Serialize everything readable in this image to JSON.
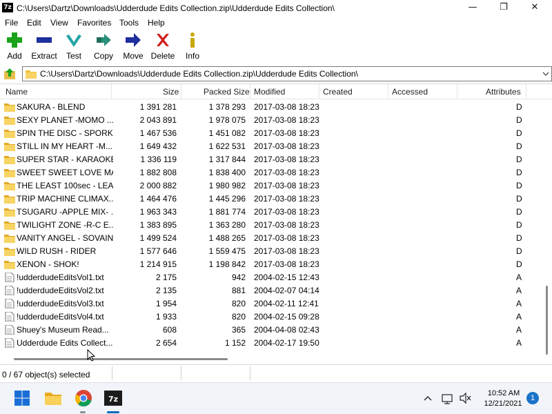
{
  "window": {
    "app_icon_text": "7z",
    "title": "C:\\Users\\Dartz\\Downloads\\Udderdude Edits Collection.zip\\Udderdude Edits Collection\\",
    "minimize_glyph": "—",
    "maximize_glyph": "❐",
    "close_glyph": "✕"
  },
  "menu": {
    "items": [
      "File",
      "Edit",
      "View",
      "Favorites",
      "Tools",
      "Help"
    ]
  },
  "toolbar": {
    "buttons": [
      {
        "label": "Add",
        "icon": "plus-icon",
        "color": "#1aa31a"
      },
      {
        "label": "Extract",
        "icon": "minus-icon",
        "color": "#1f2f9e"
      },
      {
        "label": "Test",
        "icon": "check-icon",
        "color": "#26a5a5"
      },
      {
        "label": "Copy",
        "icon": "double-arrow-icon",
        "color": "#2a8f7a"
      },
      {
        "label": "Move",
        "icon": "arrow-right-icon",
        "color": "#1f2f9e"
      },
      {
        "label": "Delete",
        "icon": "x-icon",
        "color": "#d11f1f"
      },
      {
        "label": "Info",
        "icon": "info-icon",
        "color": "#c9a800"
      }
    ]
  },
  "address": {
    "path": "C:\\Users\\Dartz\\Downloads\\Udderdude Edits Collection.zip\\Udderdude Edits Collection\\"
  },
  "columns": {
    "name": "Name",
    "size": "Size",
    "packed": "Packed Size",
    "modified": "Modified",
    "created": "Created",
    "accessed": "Accessed",
    "attributes": "Attributes"
  },
  "files": [
    {
      "name": "SAKURA - BLEND",
      "size": "1 391 281",
      "packed": "1 378 293",
      "modified": "2017-03-08 18:23",
      "attr": "D",
      "type": "folder"
    },
    {
      "name": "SEXY PLANET -MOMO ...",
      "size": "2 043 891",
      "packed": "1 978 075",
      "modified": "2017-03-08 18:23",
      "attr": "D",
      "type": "folder"
    },
    {
      "name": "SPIN THE DISC - SPORK",
      "size": "1 467 536",
      "packed": "1 451 082",
      "modified": "2017-03-08 18:23",
      "attr": "D",
      "type": "folder"
    },
    {
      "name": "STILL IN MY HEART -M...",
      "size": "1 649 432",
      "packed": "1 622 531",
      "modified": "2017-03-08 18:23",
      "attr": "D",
      "type": "folder"
    },
    {
      "name": "SUPER STAR - KARAOKE",
      "size": "1 336 119",
      "packed": "1 317 844",
      "modified": "2017-03-08 18:23",
      "attr": "D",
      "type": "folder"
    },
    {
      "name": "SWEET SWEET LOVE MA...",
      "size": "1 882 808",
      "packed": "1 838 400",
      "modified": "2017-03-08 18:23",
      "attr": "D",
      "type": "folder"
    },
    {
      "name": "THE LEAST 100sec - LEA...",
      "size": "2 000 882",
      "packed": "1 980 982",
      "modified": "2017-03-08 18:23",
      "attr": "D",
      "type": "folder"
    },
    {
      "name": "TRIP MACHINE CLIMAX...",
      "size": "1 464 476",
      "packed": "1 445 296",
      "modified": "2017-03-08 18:23",
      "attr": "D",
      "type": "folder"
    },
    {
      "name": "TSUGARU -APPLE MIX- ...",
      "size": "1 963 343",
      "packed": "1 881 774",
      "modified": "2017-03-08 18:23",
      "attr": "D",
      "type": "folder"
    },
    {
      "name": "TWILIGHT ZONE -R-C E...",
      "size": "1 383 895",
      "packed": "1 363 280",
      "modified": "2017-03-08 18:23",
      "attr": "D",
      "type": "folder"
    },
    {
      "name": "VANITY ANGEL - SOVAIN",
      "size": "1 499 524",
      "packed": "1 488 265",
      "modified": "2017-03-08 18:23",
      "attr": "D",
      "type": "folder"
    },
    {
      "name": "WILD RUSH - RIDER",
      "size": "1 577 646",
      "packed": "1 559 475",
      "modified": "2017-03-08 18:23",
      "attr": "D",
      "type": "folder"
    },
    {
      "name": "XENON - SHOK!",
      "size": "1 214 915",
      "packed": "1 198 842",
      "modified": "2017-03-08 18:23",
      "attr": "D",
      "type": "folder"
    },
    {
      "name": "!udderdudeEditsVol1.txt",
      "size": "2 175",
      "packed": "942",
      "modified": "2004-02-15 12:43",
      "attr": "A",
      "type": "file"
    },
    {
      "name": "!udderdudeEditsVol2.txt",
      "size": "2 135",
      "packed": "881",
      "modified": "2004-02-07 04:14",
      "attr": "A",
      "type": "file"
    },
    {
      "name": "!udderdudeEditsVol3.txt",
      "size": "1 954",
      "packed": "820",
      "modified": "2004-02-11 12:41",
      "attr": "A",
      "type": "file"
    },
    {
      "name": "!udderdudeEditsVol4.txt",
      "size": "1 933",
      "packed": "820",
      "modified": "2004-02-15 09:28",
      "attr": "A",
      "type": "file"
    },
    {
      "name": "Shuey's Museum Read...",
      "size": "608",
      "packed": "365",
      "modified": "2004-04-08 02:43",
      "attr": "A",
      "type": "file"
    },
    {
      "name": "Udderdude Edits Collect...",
      "size": "2 654",
      "packed": "1 152",
      "modified": "2004-02-17 19:50",
      "attr": "A",
      "type": "file"
    }
  ],
  "status": {
    "text": "0 / 67 object(s) selected"
  },
  "taskbar": {
    "apps": [
      "windows-start-icon",
      "file-explorer-icon",
      "chrome-icon",
      "7zip-icon"
    ],
    "time": "10:52 AM",
    "date": "12/21/2021",
    "notification_count": "1",
    "accent_color": "#0067c0"
  }
}
